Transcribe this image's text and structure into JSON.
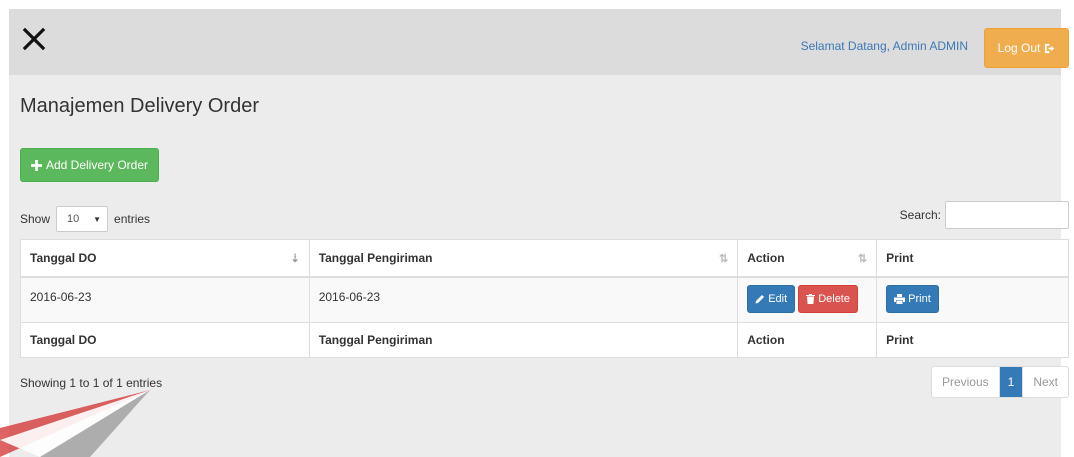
{
  "header": {
    "close_glyph": "✕",
    "welcome_text": "Selamat Datang, Admin ADMIN",
    "logout_label": "Log Out"
  },
  "page": {
    "title": "Manajemen Delivery Order",
    "add_button_label": "Add Delivery Order"
  },
  "table_controls": {
    "show_label": "Show",
    "entries_value": "10",
    "entries_label": "entries",
    "search_label": "Search:",
    "search_value": ""
  },
  "table": {
    "columns": [
      "Tanggal DO",
      "Tanggal Pengiriman",
      "Action",
      "Print"
    ],
    "rows": [
      {
        "tanggal_do": "2016-06-23",
        "tanggal_pengiriman": "2016-06-23"
      }
    ],
    "edit_label": "Edit",
    "delete_label": "Delete",
    "print_label": "Print"
  },
  "footer": {
    "info": "Showing 1 to 1 of 1 entries",
    "previous_label": "Previous",
    "current_page": "1",
    "next_label": "Next"
  },
  "colors": {
    "primary": "#337ab7",
    "success": "#5cb85c",
    "danger": "#d9534f",
    "warning": "#f0ad4e"
  }
}
